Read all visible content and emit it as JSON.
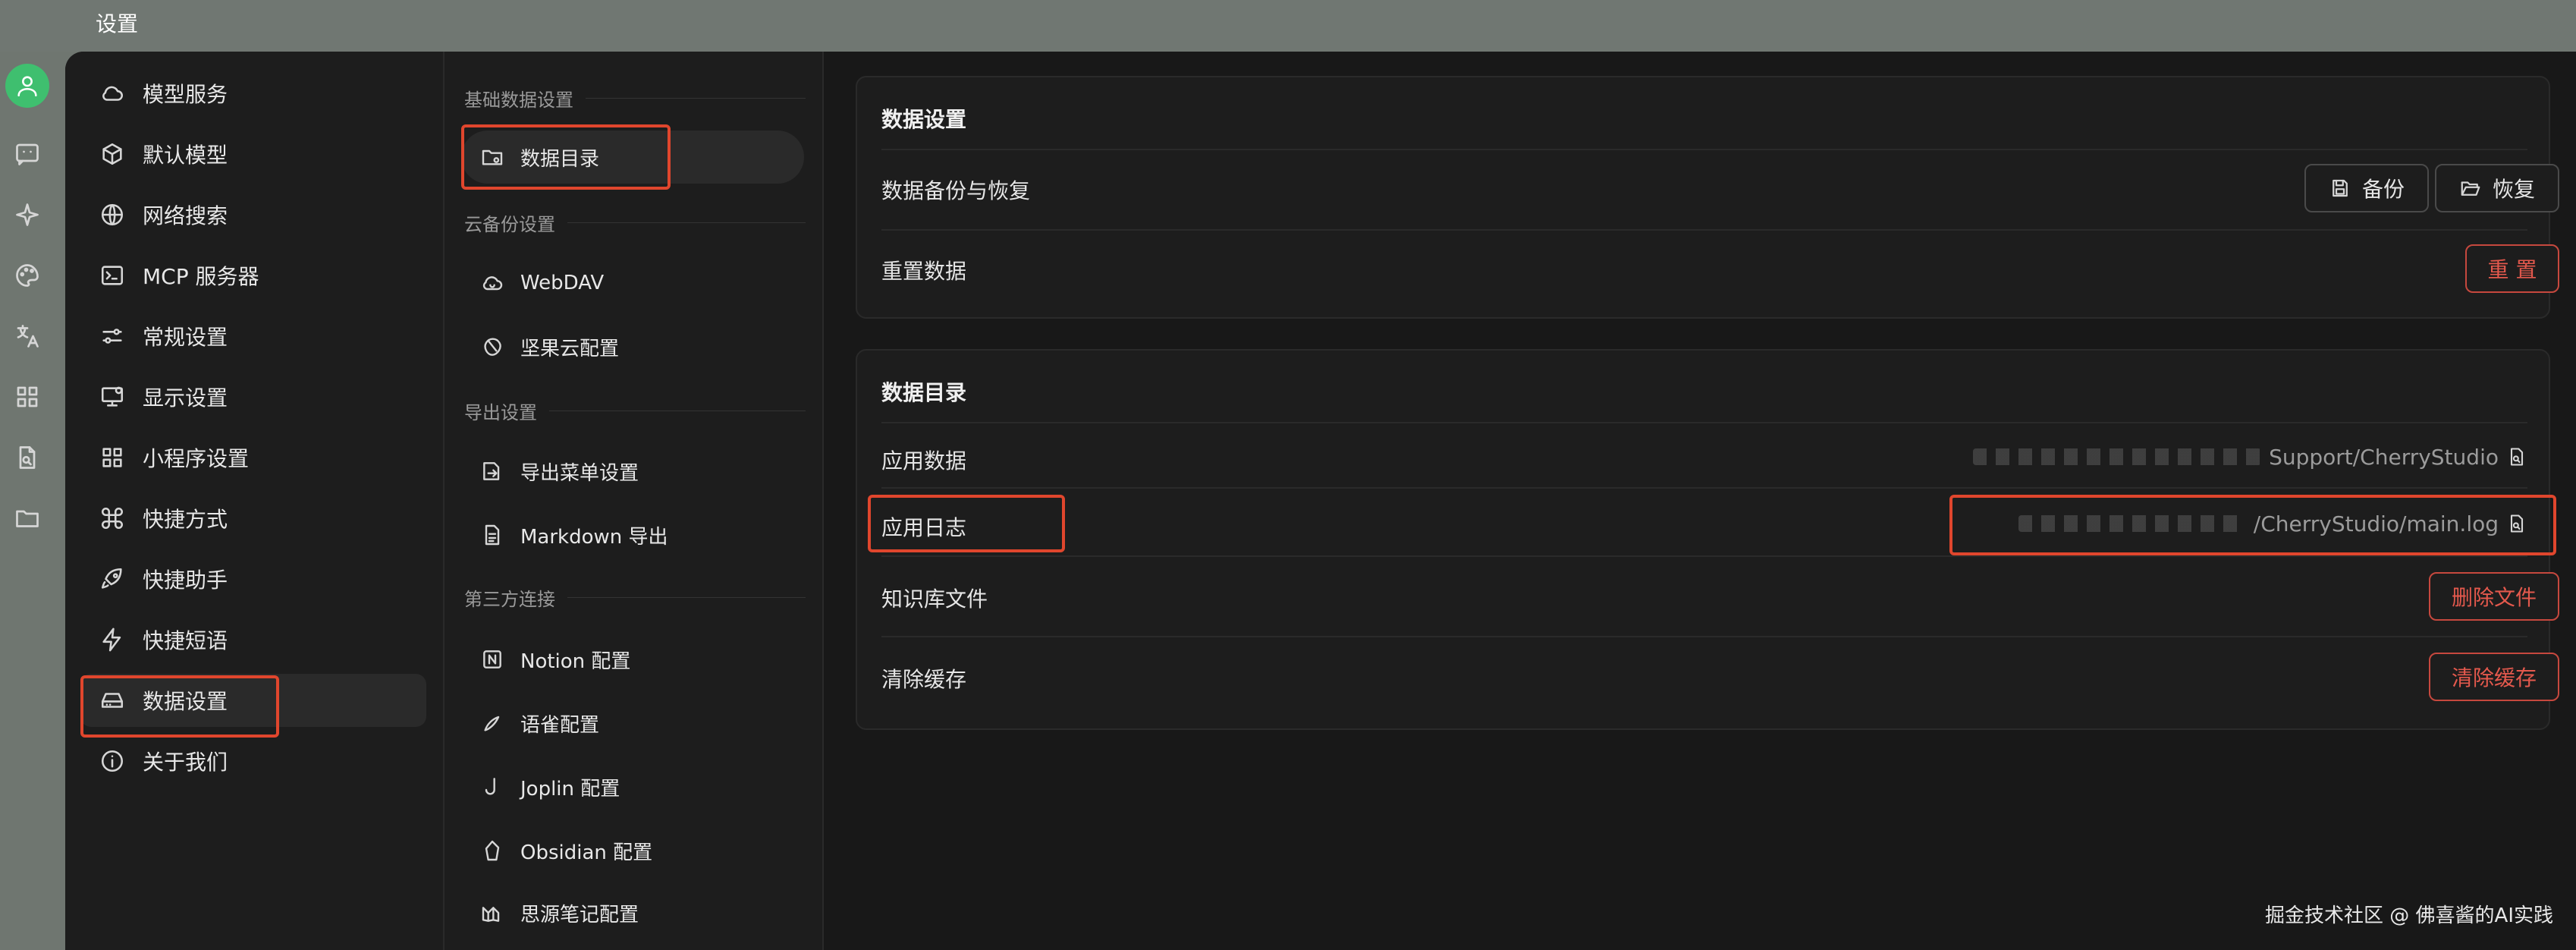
{
  "window": {
    "title": "设置"
  },
  "sidebar": {
    "items": [
      {
        "label": "模型服务",
        "icon": "cloud-icon"
      },
      {
        "label": "默认模型",
        "icon": "cube-icon"
      },
      {
        "label": "网络搜索",
        "icon": "globe-icon"
      },
      {
        "label": "MCP 服务器",
        "icon": "terminal-icon"
      },
      {
        "label": "常规设置",
        "icon": "sliders-icon"
      },
      {
        "label": "显示设置",
        "icon": "monitor-icon"
      },
      {
        "label": "小程序设置",
        "icon": "grid-icon"
      },
      {
        "label": "快捷方式",
        "icon": "command-icon"
      },
      {
        "label": "快捷助手",
        "icon": "rocket-icon"
      },
      {
        "label": "快捷短语",
        "icon": "zap-icon"
      },
      {
        "label": "数据设置",
        "icon": "hard-drive-icon"
      },
      {
        "label": "关于我们",
        "icon": "info-icon"
      }
    ],
    "active_index": 10
  },
  "subnav": {
    "sections": [
      {
        "label": "基础数据设置",
        "items": [
          {
            "label": "数据目录",
            "icon": "folder-cog-icon"
          }
        ]
      },
      {
        "label": "云备份设置",
        "items": [
          {
            "label": "WebDAV",
            "icon": "cloud-sync-icon"
          },
          {
            "label": "坚果云配置",
            "icon": "nut-icon"
          }
        ]
      },
      {
        "label": "导出设置",
        "items": [
          {
            "label": "导出菜单设置",
            "icon": "export-icon"
          },
          {
            "label": "Markdown 导出",
            "icon": "file-text-icon"
          }
        ]
      },
      {
        "label": "第三方连接",
        "items": [
          {
            "label": "Notion 配置",
            "icon": "notion-icon"
          },
          {
            "label": "语雀配置",
            "icon": "yuque-icon"
          },
          {
            "label": "Joplin 配置",
            "icon": "joplin-icon"
          },
          {
            "label": "Obsidian 配置",
            "icon": "obsidian-icon"
          },
          {
            "label": "思源笔记配置",
            "icon": "siyuan-icon"
          }
        ]
      }
    ],
    "active": "数据目录"
  },
  "data_settings": {
    "title": "数据设置",
    "backup_label": "数据备份与恢复",
    "backup_button": "备份",
    "restore_button": "恢复",
    "reset_label": "重置数据",
    "reset_button": "重 置"
  },
  "data_directory": {
    "title": "数据目录",
    "app_data_label": "应用数据",
    "app_data_path": "Support/CherryStudio",
    "app_log_label": "应用日志",
    "app_log_path": "/CherryStudio/main.log",
    "kb_label": "知识库文件",
    "kb_button": "删除文件",
    "cache_label": "清除缓存",
    "cache_button": "清除缓存"
  },
  "watermark": "掘金技术社区 @ 佛喜酱的AI实践",
  "colors": {
    "accent_green": "#3fbf6f",
    "danger": "#e4594d",
    "highlight": "#e0462d"
  }
}
